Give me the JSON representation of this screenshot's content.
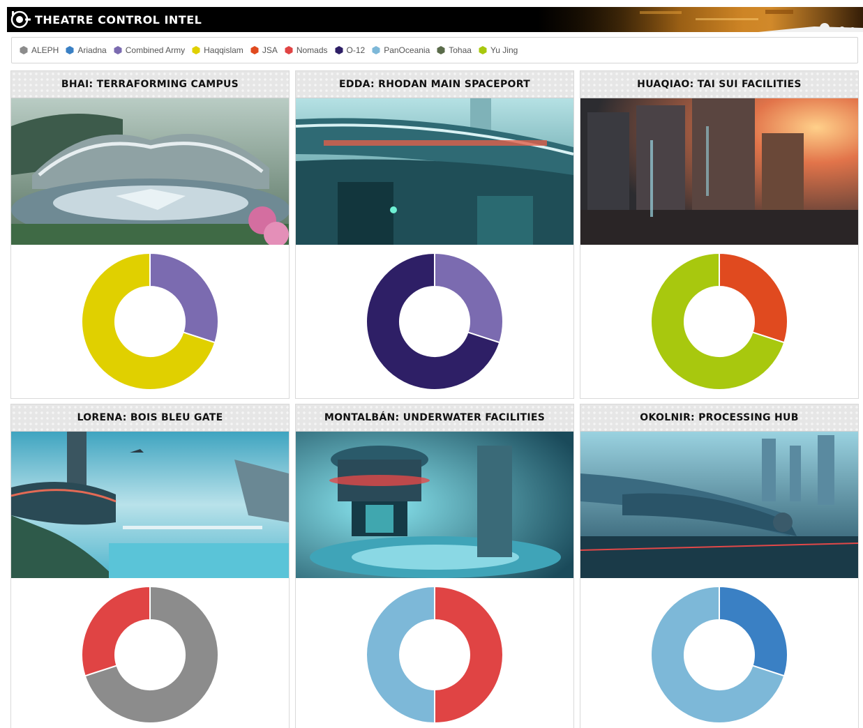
{
  "header": {
    "title": "THEATRE CONTROL INTEL"
  },
  "legend": [
    {
      "name": "ALEPH",
      "color": "#8c8c8c",
      "icon": "hexagon-icon"
    },
    {
      "name": "Ariadna",
      "color": "#3a80c4",
      "icon": "hexagon-icon"
    },
    {
      "name": "Combined Army",
      "color": "#7b6bb0",
      "icon": "hexagon-icon"
    },
    {
      "name": "Haqqislam",
      "color": "#e0d000",
      "icon": "hexagon-icon"
    },
    {
      "name": "JSA",
      "color": "#e04a1f",
      "icon": "hexagon-icon"
    },
    {
      "name": "Nomads",
      "color": "#e04444",
      "icon": "hexagon-icon"
    },
    {
      "name": "O-12",
      "color": "#2e1f66",
      "icon": "hexagon-icon"
    },
    {
      "name": "PanOceania",
      "color": "#7db8d8",
      "icon": "hexagon-icon"
    },
    {
      "name": "Tohaa",
      "color": "#5a6b4a",
      "icon": "hexagon-icon"
    },
    {
      "name": "Yu Jing",
      "color": "#a8c80e",
      "icon": "hexagon-icon"
    }
  ],
  "cards": [
    {
      "title": "BHAI: TERRAFORMING CAMPUS",
      "image": "futuristic-campus-image",
      "chart_data": {
        "type": "pie",
        "categories": [
          "Combined Army",
          "Haqqislam"
        ],
        "values": [
          30,
          70
        ],
        "colors": [
          "#7b6bb0",
          "#e0d000"
        ]
      }
    },
    {
      "title": "EDDA: RHODAN MAIN SPACEPORT",
      "image": "spaceport-image",
      "chart_data": {
        "type": "pie",
        "categories": [
          "Combined Army",
          "O-12"
        ],
        "values": [
          30,
          70
        ],
        "colors": [
          "#7b6bb0",
          "#2e1f66"
        ]
      }
    },
    {
      "title": "HUAQIAO: TAI SUI FACILITIES",
      "image": "sunset-city-image",
      "chart_data": {
        "type": "pie",
        "categories": [
          "JSA",
          "Yu Jing"
        ],
        "values": [
          30,
          70
        ],
        "colors": [
          "#e04a1f",
          "#a8c80e"
        ]
      }
    },
    {
      "title": "LORENA: BOIS BLEU GATE",
      "image": "waterfall-gate-image",
      "chart_data": {
        "type": "pie",
        "categories": [
          "ALEPH",
          "Nomads"
        ],
        "values": [
          70,
          30
        ],
        "colors": [
          "#8c8c8c",
          "#e04444"
        ]
      }
    },
    {
      "title": "MONTALBÁN: UNDERWATER FACILITIES",
      "image": "underwater-facility-image",
      "chart_data": {
        "type": "pie",
        "categories": [
          "Nomads",
          "PanOceania"
        ],
        "values": [
          50,
          50
        ],
        "colors": [
          "#e04444",
          "#7db8d8"
        ]
      }
    },
    {
      "title": "OKOLNIR: PROCESSING HUB",
      "image": "industrial-hub-image",
      "chart_data": {
        "type": "pie",
        "categories": [
          "Ariadna",
          "PanOceania"
        ],
        "values": [
          30,
          70
        ],
        "colors": [
          "#3a80c4",
          "#7db8d8"
        ]
      }
    }
  ]
}
